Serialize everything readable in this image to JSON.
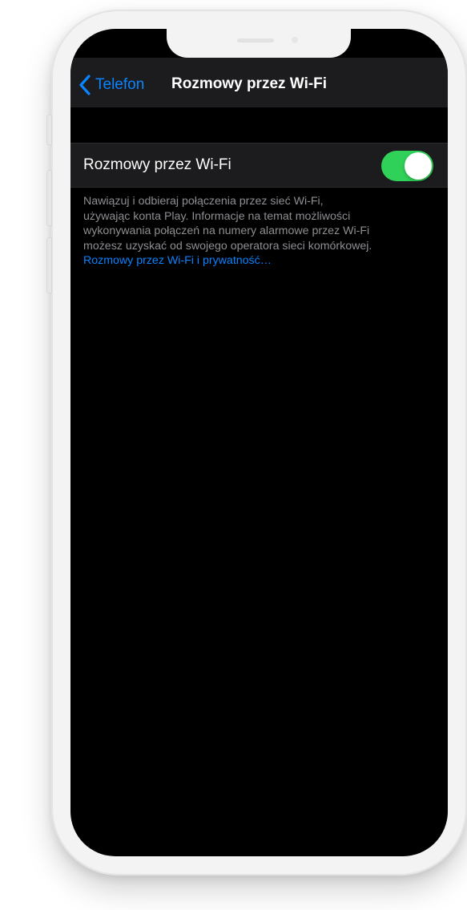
{
  "colors": {
    "accent": "#0a84ff",
    "toggle_on": "#30d158",
    "screen_background": "#000000",
    "cell_background": "#1c1c1e",
    "secondary_text": "#8e8e93"
  },
  "nav": {
    "back_icon": "chevron-left-icon",
    "back_label": "Telefon",
    "title": "Rozmowy przez Wi-Fi"
  },
  "setting": {
    "label": "Rozmowy przez Wi-Fi",
    "toggle_state": "on"
  },
  "footer": {
    "lines": [
      "Nawiązuj i odbieraj połączenia przez sieć Wi-Fi,",
      "używając konta Play. Informacje na temat możliwości",
      "wykonywania połączeń na numery alarmowe przez Wi-Fi",
      "możesz uzyskać od swojego operatora sieci komórkowej."
    ],
    "link": "Rozmowy przez Wi-Fi i prywatność…"
  }
}
